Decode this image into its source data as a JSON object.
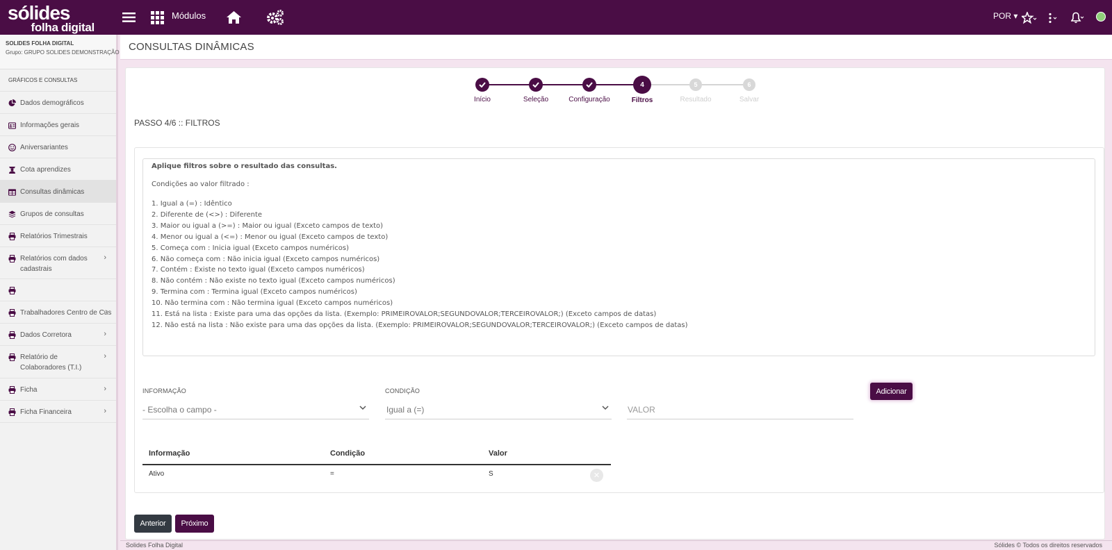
{
  "topbar": {
    "logo_main": "sólides",
    "logo_sub": "folha digital",
    "modules_label": "Módulos",
    "language": "POR"
  },
  "sidebar": {
    "org_name": "SOLIDES FOLHA DIGITAL",
    "org_group": "Grupo: GRUPO SOLIDES DEMONSTRAÇÃO",
    "section_title": "GRÁFICOS E CONSULTAS",
    "items": [
      {
        "label": "Dados demográficos",
        "icon": "pie-chart-icon",
        "chevron": false
      },
      {
        "label": "Informações gerais",
        "icon": "id-card-icon",
        "chevron": false
      },
      {
        "label": "Aniversariantes",
        "icon": "smile-icon",
        "chevron": false
      },
      {
        "label": "Cota aprendizes",
        "icon": "graduation-icon",
        "chevron": false
      },
      {
        "label": "Consultas dinâmicas",
        "icon": "table-icon",
        "chevron": false,
        "active": true
      },
      {
        "label": "Grupos de consultas",
        "icon": "layers-icon",
        "chevron": false
      },
      {
        "label": "Relatórios Trimestrais",
        "icon": "print-icon",
        "chevron": false
      },
      {
        "label": "Relatórios com dados cadastrais",
        "icon": "print-icon",
        "chevron": true
      },
      {
        "label": "",
        "icon": "print-icon",
        "chevron": false
      },
      {
        "label": "Trabalhadores Centro de Custo",
        "icon": "print-icon",
        "chevron": true
      },
      {
        "label": "Dados Corretora",
        "icon": "print-icon",
        "chevron": true
      },
      {
        "label": "Relatório de Colaboradores (T.I.)",
        "icon": "print-icon",
        "chevron": true
      },
      {
        "label": "Ficha",
        "icon": "print-icon",
        "chevron": true
      },
      {
        "label": "Ficha Financeira",
        "icon": "print-icon",
        "chevron": true
      }
    ]
  },
  "page_title": "CONSULTAS DINÂMICAS",
  "stepper": {
    "steps": [
      {
        "label": "Início",
        "state": "done",
        "number": ""
      },
      {
        "label": "Seleção",
        "state": "done",
        "number": ""
      },
      {
        "label": "Configuração",
        "state": "done",
        "number": ""
      },
      {
        "label": "Filtros",
        "state": "current",
        "number": "4"
      },
      {
        "label": "Resultado",
        "state": "todo",
        "number": "5"
      },
      {
        "label": "Salvar",
        "state": "todo",
        "number": "6"
      }
    ]
  },
  "step_title": "PASSO 4/6 :: FILTROS",
  "help": {
    "title": "Aplique filtros sobre o resultado das consultas.",
    "conditions_label": "Condições ao valor filtrado :",
    "lines": [
      "1. Igual a (=) : Idêntico",
      "2. Diferente de (<>) : Diferente",
      "3. Maior ou igual a (>=) : Maior ou igual (Exceto campos de texto)",
      "4. Menor ou igual a (<=) : Menor ou igual (Exceto campos de texto)",
      "5. Começa com : Inicia igual (Exceto campos numéricos)",
      "6. Não começa com : Não inicia igual (Exceto campos numéricos)",
      "7. Contém : Existe no texto igual (Exceto campos numéricos)",
      "8. Não contém : Não existe no texto igual (Exceto campos numéricos)",
      "9. Termina com : Termina igual (Exceto campos numéricos)",
      "10. Não termina com : Não termina igual (Exceto campos numéricos)",
      "11. Está na lista : Existe para uma das opções da lista. (Exemplo: PRIMEIROVALOR;SEGUNDOVALOR;TERCEIROVALOR;) (Exceto campos de datas)",
      "12. Não está na lista : Não existe para uma das opções da lista. (Exemplo: PRIMEIROVALOR;SEGUNDOVALOR;TERCEIROVALOR;) (Exceto campos de datas)"
    ]
  },
  "form": {
    "info_label": "INFORMAÇÃO",
    "info_value": "- Escolha o campo -",
    "cond_label": "CONDIÇÃO",
    "cond_value": "Igual a (=)",
    "value_placeholder": "VALOR",
    "add_button": "Adicionar"
  },
  "table": {
    "headers": [
      "Informação",
      "Condição",
      "Valor"
    ],
    "rows": [
      [
        "Ativo",
        "=",
        "S"
      ]
    ]
  },
  "buttons": {
    "prev": "Anterior",
    "next": "Próximo"
  },
  "footer": {
    "left": "Solides Folha Digital",
    "right": "Sólides © Todos os direitos reservados"
  },
  "colors": {
    "brand": "#4a0d45",
    "background": "#f4e4ef"
  }
}
